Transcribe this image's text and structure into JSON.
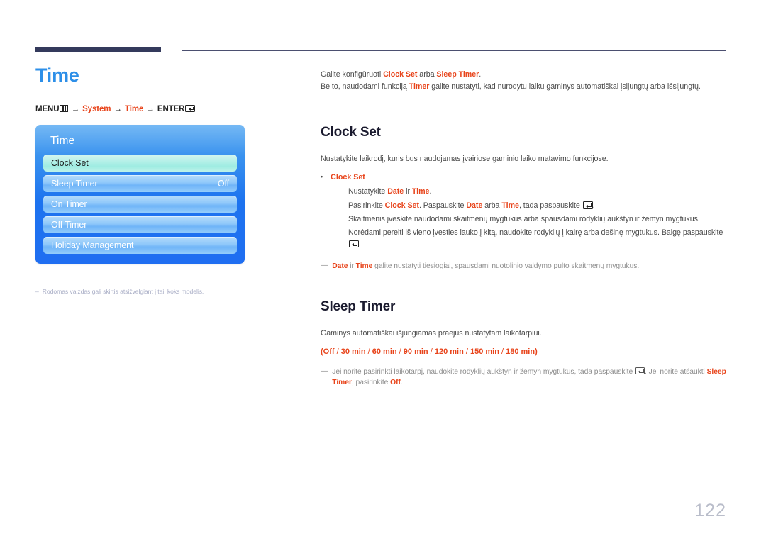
{
  "page": {
    "title": "Time",
    "number": "122",
    "menu_path": {
      "menu_label": "MENU",
      "menu_icon": "menu-bars-icon",
      "arrow": "→",
      "step1": "System",
      "step2": "Time",
      "enter_label": "ENTER",
      "enter_icon": "enter-key-icon"
    }
  },
  "osd": {
    "title": "Time",
    "items": [
      {
        "label": "Clock Set",
        "value": "",
        "selected": true
      },
      {
        "label": "Sleep Timer",
        "value": "Off",
        "selected": false
      },
      {
        "label": "On Timer",
        "value": "",
        "selected": false
      },
      {
        "label": "Off Timer",
        "value": "",
        "selected": false
      },
      {
        "label": "Holiday Management",
        "value": "",
        "selected": false
      }
    ]
  },
  "left_footnote": {
    "dash": "–",
    "text": "Rodomas vaizdas gali skirtis atsižvelgiant į tai, koks modelis."
  },
  "intro": {
    "line1_a": "Galite konfigūruoti ",
    "line1_hi1": "Clock Set",
    "line1_b": " arba ",
    "line1_hi2": "Sleep Timer",
    "line1_c": ".",
    "line2_a": "Be to, naudodami funkciją ",
    "line2_hi1": "Timer",
    "line2_b": " galite nustatyti, kad nurodytu laiku gaminys automatiškai įsijungtų arba išsijungtų."
  },
  "clock_set": {
    "heading": "Clock Set",
    "lead": "Nustatykite laikrodį, kuris bus naudojamas įvairiose gaminio laiko matavimo funkcijose.",
    "bullet_label": "Clock Set",
    "b1_a": "Nustatykite ",
    "b1_hi1": "Date",
    "b1_b": " ir ",
    "b1_hi2": "Time",
    "b1_c": ".",
    "b2_a": "Pasirinkite ",
    "b2_hi1": "Clock Set",
    "b2_b": ". Paspauskite ",
    "b2_hi2": "Date",
    "b2_c": " arba ",
    "b2_hi3": "Time",
    "b2_d": ", tada paspauskite ",
    "b2_e": ".",
    "b3": "Skaitmenis įveskite naudodami skaitmenų mygtukus arba spausdami rodyklių aukštyn ir žemyn mygtukus.",
    "b4_a": "Norėdami pereiti iš vieno įvesties lauko į kitą, naudokite rodyklių į kairę arba dešinę mygtukus. Baigę paspauskite ",
    "b4_b": ".",
    "note_dash": "―",
    "note_hi1": "Date",
    "note_a": " ir ",
    "note_hi2": "Time",
    "note_b": " galite nustatyti tiesiogiai, spausdami nuotolinio valdymo pulto skaitmenų mygtukus."
  },
  "sleep_timer": {
    "heading": "Sleep Timer",
    "lead": "Gaminys automatiškai išjungiamas praėjus nustatytam laikotarpiui.",
    "options_open": "(",
    "options": [
      "Off",
      "30 min",
      "60 min",
      "90 min",
      "120 min",
      "150 min",
      "180 min"
    ],
    "options_sep": " / ",
    "options_close": ")",
    "note_dash": "―",
    "note_a": "Jei norite pasirinkti laikotarpį, naudokite rodyklių aukštyn ir žemyn mygtukus, tada paspauskite ",
    "note_b": ". Jei norite atšaukti ",
    "note_hi1": "Sleep Timer",
    "note_c": ", pasirinkite ",
    "note_hi2": "Off",
    "note_d": "."
  },
  "colors": {
    "accent_blue": "#2d8fe8",
    "accent_orange": "#e8441b",
    "rule_navy": "#343a5c",
    "osd_blue": "#1d73ef",
    "osd_selected": "#b4f0e8",
    "page_number": "#b9bdca"
  }
}
